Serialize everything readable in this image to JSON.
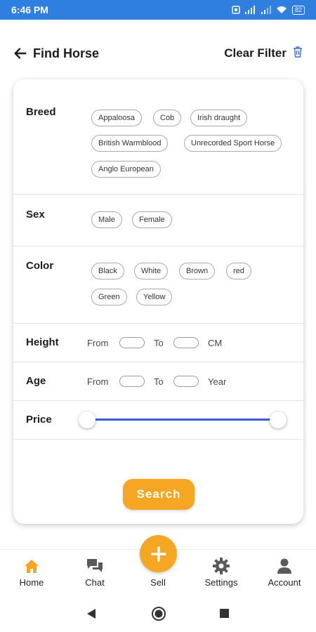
{
  "status_bar": {
    "time": "6:46 PM",
    "battery": "82"
  },
  "header": {
    "title": "Find Horse",
    "clear_filter": "Clear Filter"
  },
  "filters": {
    "breed": {
      "label": "Breed",
      "options": [
        "Appaloosa",
        "Cob",
        "Irish draught",
        "British Warmblood",
        "Unrecorded Sport Horse",
        "Anglo European"
      ]
    },
    "sex": {
      "label": "Sex",
      "options": [
        "Male",
        "Female"
      ]
    },
    "color": {
      "label": "Color",
      "options": [
        "Black",
        "White",
        "Brown",
        "red",
        "Green",
        "Yellow"
      ]
    },
    "height": {
      "label": "Height",
      "from": "From",
      "to": "To",
      "unit": "CM"
    },
    "age": {
      "label": "Age",
      "from": "From",
      "to": "To",
      "unit": "Year"
    },
    "price": {
      "label": "Price",
      "range_min_fraction": 0,
      "range_max_fraction": 1
    }
  },
  "search_button": "Search",
  "bottom_nav": {
    "home": "Home",
    "chat": "Chat",
    "sell": "Sell",
    "settings": "Settings",
    "account": "Account"
  },
  "colors": {
    "accent": "#f5a623",
    "status_bar": "#2f7fe0",
    "slider": "#3d5bd6",
    "active_nav": "#f5a623"
  },
  "icons": {
    "back": "arrow-left-icon",
    "clear": "trash-icon",
    "home": "home-icon",
    "chat": "chat-icon",
    "sell": "plus-icon",
    "settings": "gear-icon",
    "account": "person-icon"
  }
}
